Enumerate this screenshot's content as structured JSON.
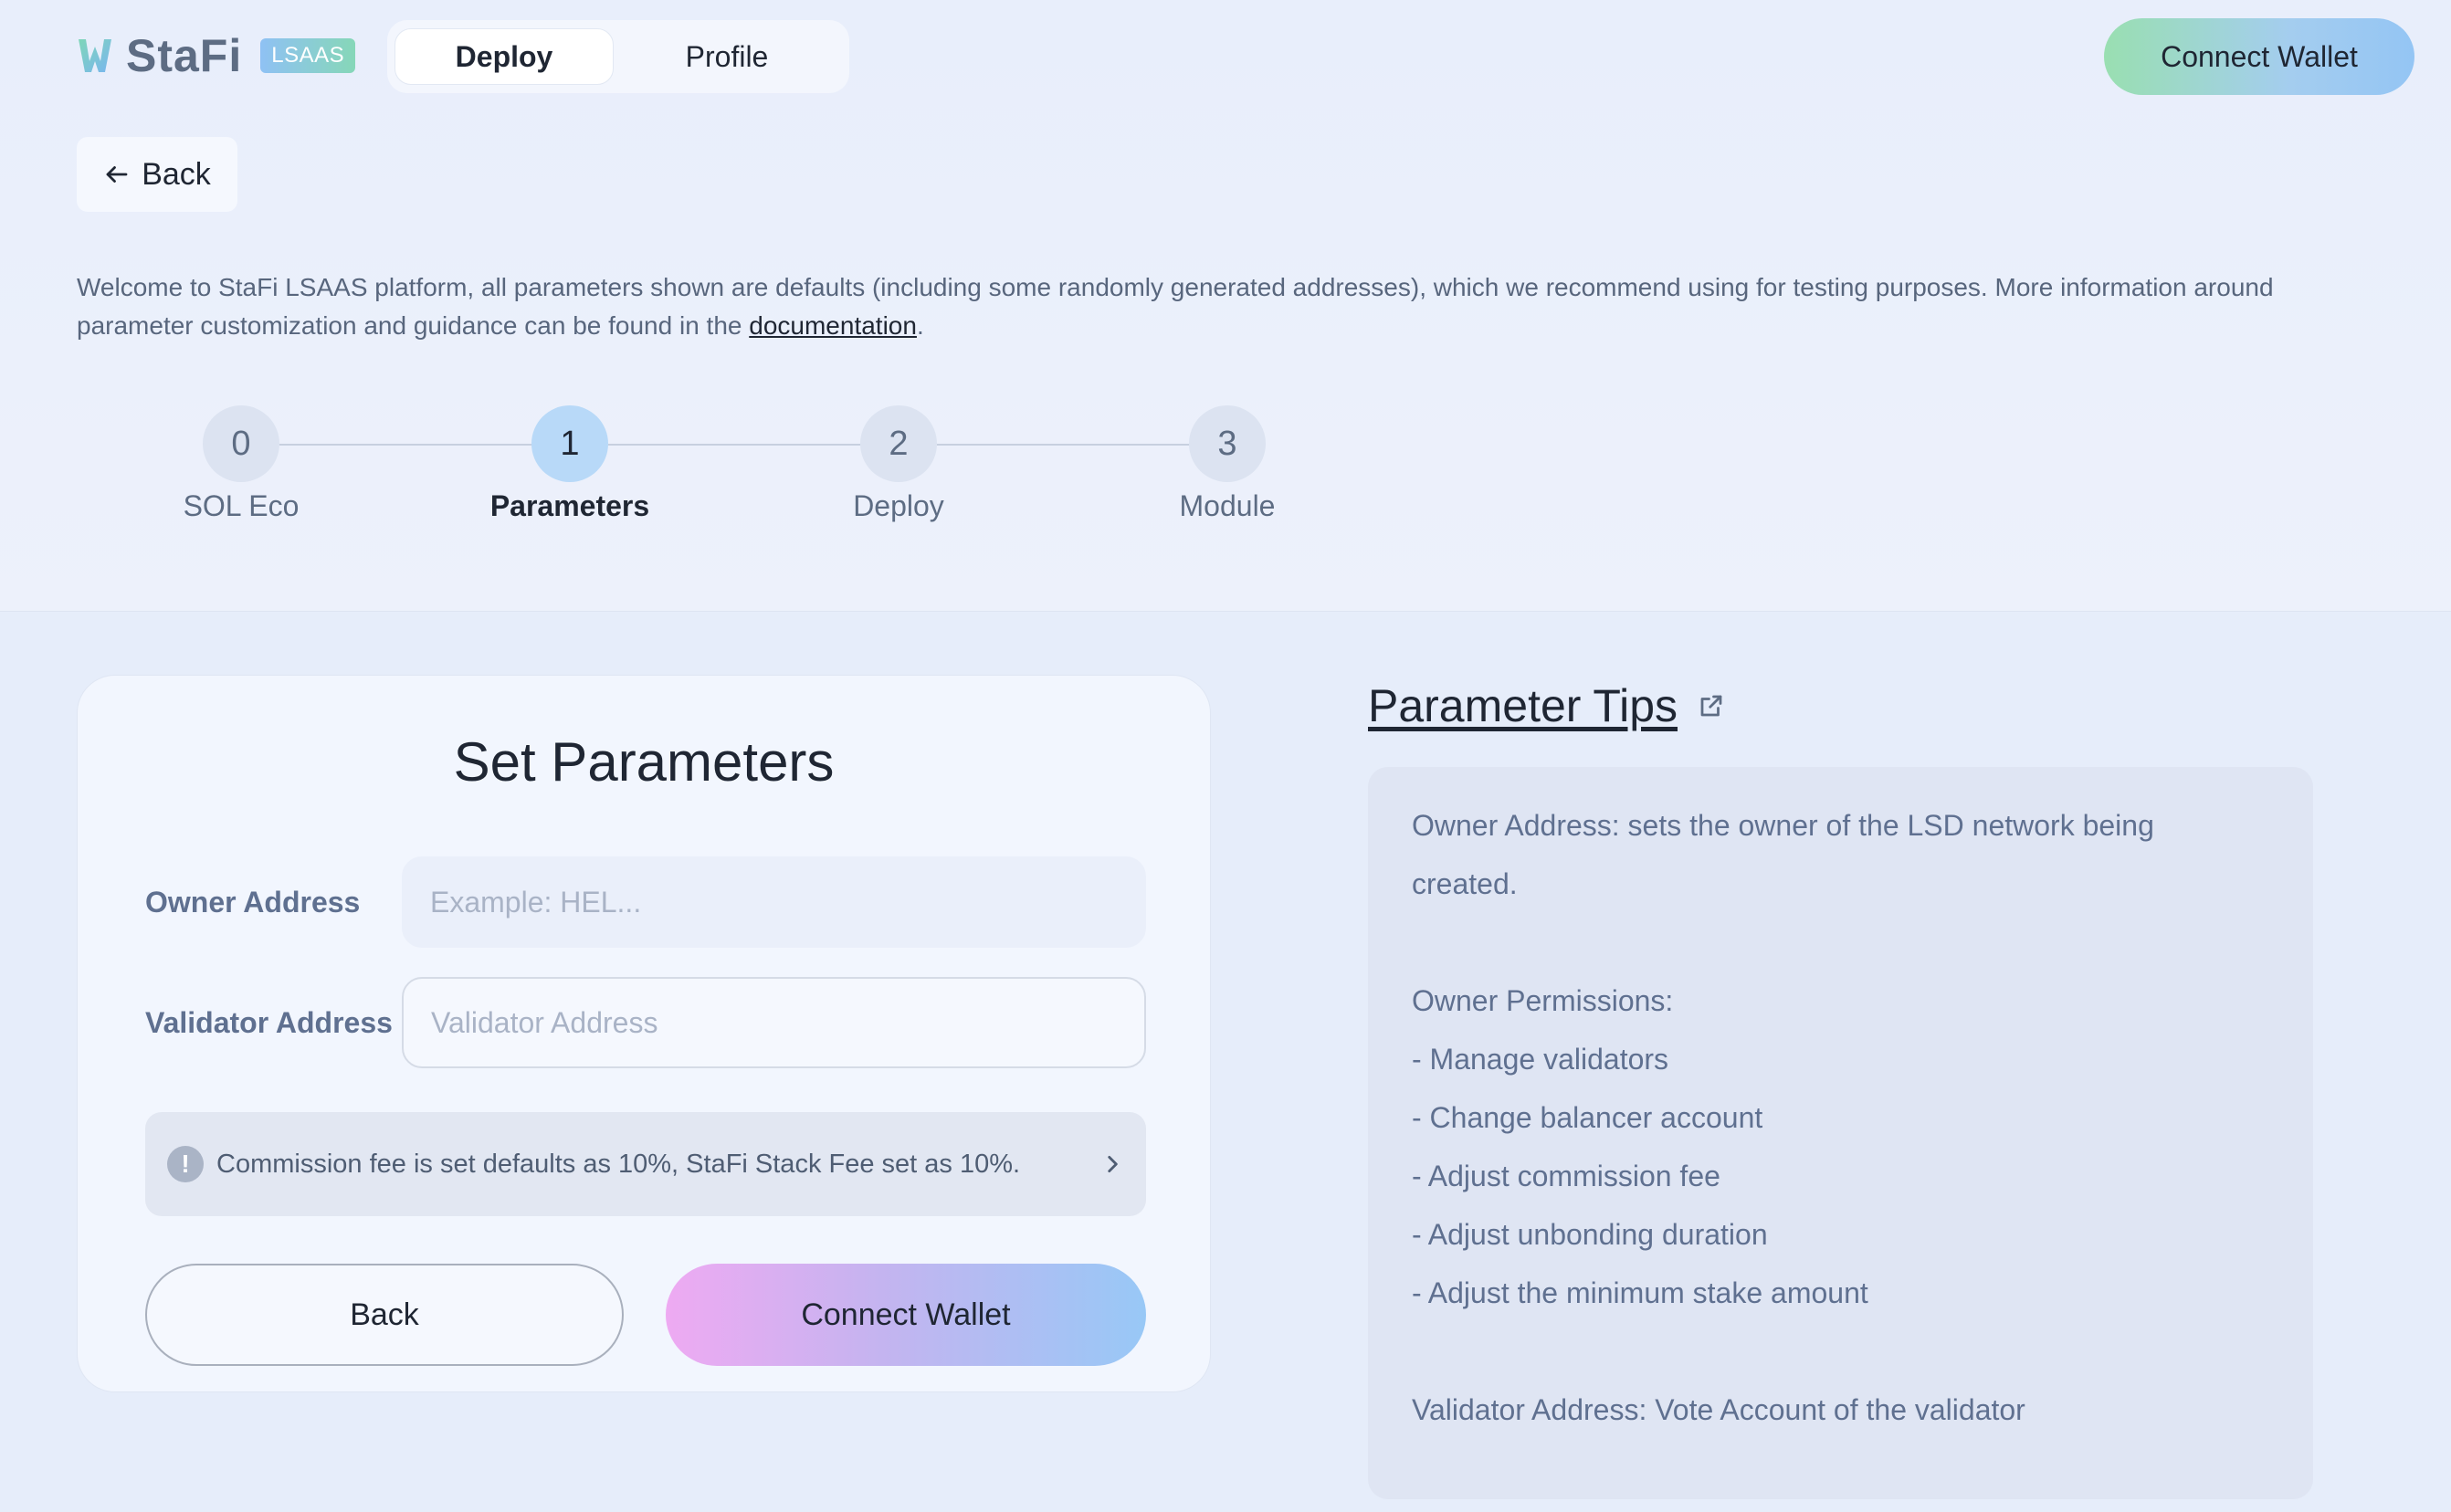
{
  "header": {
    "logo_text": "StaFi",
    "logo_badge": "LSAAS",
    "tabs": [
      {
        "label": "Deploy",
        "active": true
      },
      {
        "label": "Profile",
        "active": false
      }
    ],
    "connect_wallet_label": "Connect Wallet"
  },
  "back_label": "Back",
  "welcome": {
    "text_before": "Welcome to StaFi LSAAS platform, all parameters shown are defaults (including some randomly generated addresses), which we recommend using for testing purposes. More information around parameter customization and guidance can be found in the ",
    "link_text": "documentation",
    "text_after": "."
  },
  "stepper": {
    "steps": [
      {
        "number": "0",
        "label": "SOL Eco"
      },
      {
        "number": "1",
        "label": "Parameters"
      },
      {
        "number": "2",
        "label": "Deploy"
      },
      {
        "number": "3",
        "label": "Module"
      }
    ],
    "active_index": 1
  },
  "form": {
    "title": "Set Parameters",
    "owner_address": {
      "label": "Owner Address",
      "value": "",
      "placeholder": "Example: HEL..."
    },
    "validator_address": {
      "label": "Validator Address",
      "value": "",
      "placeholder": "Validator Address"
    },
    "notice": {
      "icon": "exclamation-icon",
      "text": "Commission fee is set defaults as 10%, StaFi Stack Fee set as 10%."
    },
    "back_button": "Back",
    "connect_button": "Connect Wallet"
  },
  "tips": {
    "title": "Parameter Tips",
    "lines": [
      "Owner Address: sets the owner of the LSD network being",
      "created.",
      "",
      "Owner Permissions:",
      "- Manage validators",
      "- Change balancer account",
      "- Adjust commission fee",
      "- Adjust unbonding duration",
      "- Adjust the minimum stake amount",
      "",
      "Validator Address: Vote Account of the validator"
    ]
  },
  "colors": {
    "background": "#e8eefb",
    "text_primary": "#1f2633",
    "text_muted": "#5f7090",
    "step_active": "#b8d9f8"
  }
}
